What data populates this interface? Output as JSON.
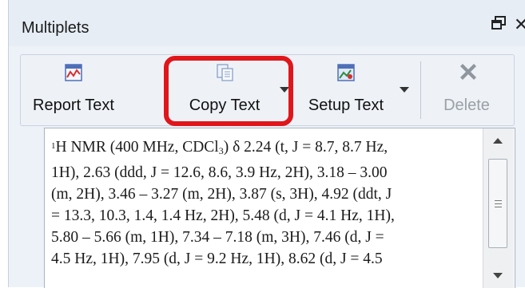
{
  "panel": {
    "title": "Multiplets"
  },
  "toolbar": {
    "buttons": [
      {
        "label": "Report Text",
        "icon": "report-text-icon"
      },
      {
        "label": "Copy Text",
        "icon": "copy-text-icon"
      },
      {
        "label": "Setup Text",
        "icon": "setup-text-icon"
      },
      {
        "label": "Delete",
        "icon": "delete-icon",
        "disabled": true
      }
    ]
  },
  "report": {
    "superscript": "1",
    "nucleus": "H NMR (400 MHz, CDCl",
    "subscript": "3",
    "line1_rest": ") δ 2.24 (t, J = 8.7, 8.7 Hz,",
    "line2": "1H), 2.63 (ddd, J = 12.6, 8.6, 3.9 Hz, 2H), 3.18 – 3.00",
    "line3": "(m, 2H), 3.46 – 3.27 (m, 2H), 3.87 (s, 3H), 4.92 (ddt, J",
    "line4": "= 13.3, 10.3, 1.4, 1.4 Hz, 2H), 5.48 (d, J = 4.1 Hz, 1H),",
    "line5": "5.80 – 5.66 (m, 1H), 7.34 – 7.18 (m, 3H), 7.46 (d, J =",
    "line6": "4.5 Hz, 1H), 7.95 (d, J = 9.2 Hz, 1H), 8.62 (d, J = 4.5"
  },
  "colors": {
    "highlight": "#e0161b",
    "panel_bg": "#edf2f8"
  }
}
